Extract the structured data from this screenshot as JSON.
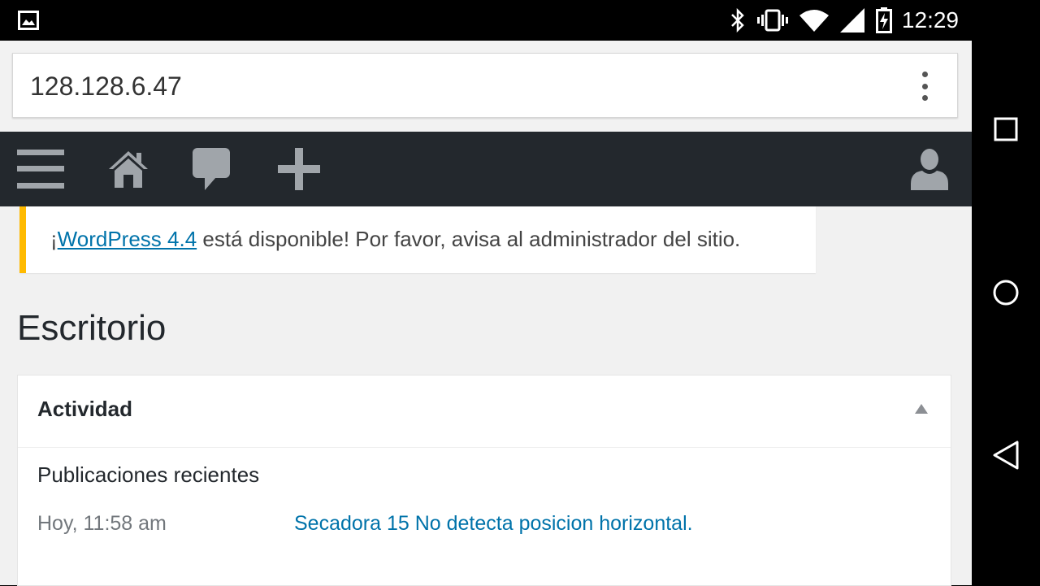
{
  "status_bar": {
    "time": "12:29",
    "icons": [
      "image-notification-icon",
      "bluetooth-icon",
      "vibrate-icon",
      "wifi-icon",
      "cell-signal-icon",
      "battery-charging-icon"
    ]
  },
  "browser": {
    "url": "128.128.6.47",
    "menu_icon": "more-vert-icon"
  },
  "admin_bar": {
    "items": [
      "menu-icon",
      "home-icon",
      "comments-icon",
      "add-new-icon",
      "user-account-icon"
    ]
  },
  "notice": {
    "prefix": "¡",
    "link_text": "WordPress 4.4",
    "suffix": " está disponible! Por favor, avisa al administrador del sitio.",
    "accent_color": "#ffba00"
  },
  "page": {
    "title": "Escritorio"
  },
  "activity_box": {
    "title": "Actividad",
    "section_title": "Publicaciones recientes",
    "posts": [
      {
        "date": "Hoy, 11:58 am",
        "title": "Secadora 15 No detecta posicion horizontal."
      }
    ]
  },
  "nav_bar": {
    "buttons": [
      "recents-icon",
      "home-circle-icon",
      "back-icon"
    ]
  },
  "colors": {
    "admin_bar_bg": "#23282d",
    "link": "#0073aa",
    "page_bg": "#f1f1f1"
  }
}
